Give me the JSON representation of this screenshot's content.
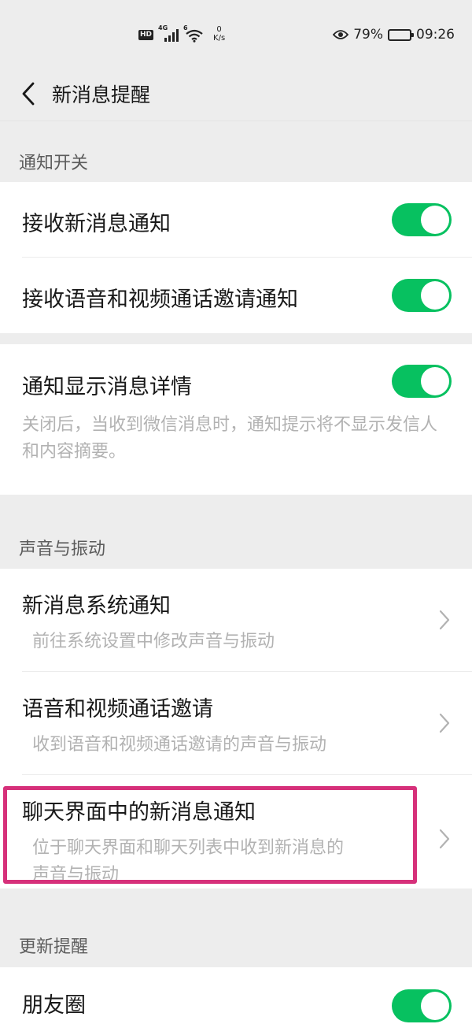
{
  "status_bar": {
    "hd": "HD",
    "network": "4G",
    "wifi": "6",
    "speed_value": "0",
    "speed_unit": "K/s",
    "battery": "79%",
    "time": "09:26"
  },
  "nav": {
    "title": "新消息提醒"
  },
  "sections": {
    "notify_switch": {
      "header": "通知开关",
      "receive_new_msg": "接收新消息通知",
      "receive_call_invite": "接收语音和视频通话邀请通知"
    },
    "detail": {
      "title": "通知显示消息详情",
      "desc": "关闭后，当收到微信消息时，通知提示将不显示发信人和内容摘要。"
    },
    "sound_vibration": {
      "header": "声音与振动",
      "items": [
        {
          "title": "新消息系统通知",
          "desc": "前往系统设置中修改声音与振动"
        },
        {
          "title": "语音和视频通话邀请",
          "desc": "收到语音和视频通话邀请的声音与振动"
        },
        {
          "title": "聊天界面中的新消息通知",
          "desc": "位于聊天界面和聊天列表中收到新消息的",
          "desc2": "声音与振动"
        }
      ]
    },
    "update": {
      "header": "更新提醒",
      "moments": "朋友圈"
    }
  },
  "toggles": {
    "receive_new_msg": true,
    "receive_call_invite": true,
    "show_detail": true,
    "moments": true
  },
  "colors": {
    "toggle_on": "#07c160",
    "highlight": "#d6307a",
    "background": "#ededed"
  }
}
